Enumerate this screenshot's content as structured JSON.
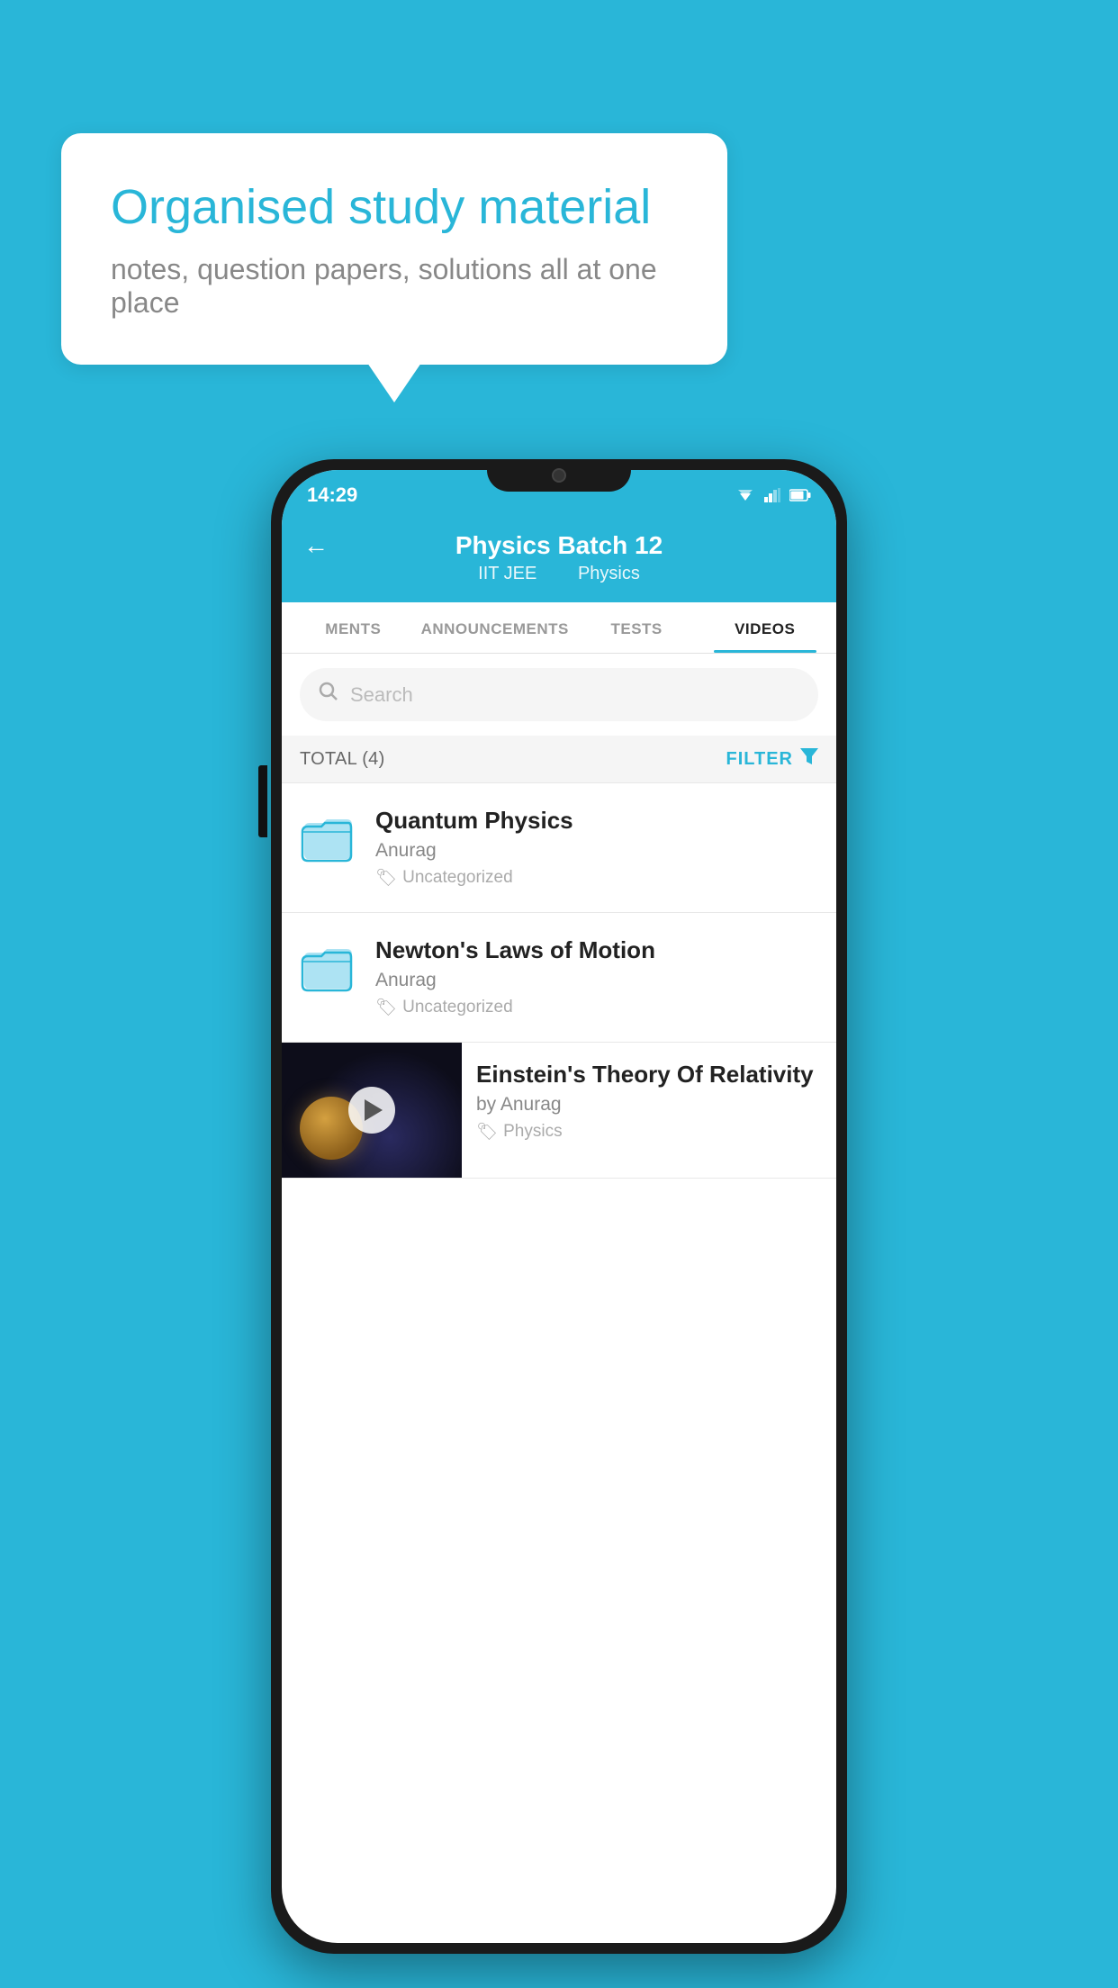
{
  "background_color": "#29B6D8",
  "speech_bubble": {
    "title": "Organised study material",
    "subtitle": "notes, question papers, solutions all at one place"
  },
  "status_bar": {
    "time": "14:29"
  },
  "header": {
    "title": "Physics Batch 12",
    "subtitle_part1": "IIT JEE",
    "subtitle_part2": "Physics",
    "back_label": "←"
  },
  "tabs": [
    {
      "label": "MENTS",
      "active": false
    },
    {
      "label": "ANNOUNCEMENTS",
      "active": false
    },
    {
      "label": "TESTS",
      "active": false
    },
    {
      "label": "VIDEOS",
      "active": true
    }
  ],
  "search": {
    "placeholder": "Search"
  },
  "filter_bar": {
    "total_label": "TOTAL (4)",
    "filter_label": "FILTER"
  },
  "list_items": [
    {
      "title": "Quantum Physics",
      "author": "Anurag",
      "tag": "Uncategorized",
      "has_thumb": false
    },
    {
      "title": "Newton's Laws of Motion",
      "author": "Anurag",
      "tag": "Uncategorized",
      "has_thumb": false
    },
    {
      "title": "Einstein's Theory Of Relativity",
      "author": "by Anurag",
      "tag": "Physics",
      "has_thumb": true
    }
  ]
}
